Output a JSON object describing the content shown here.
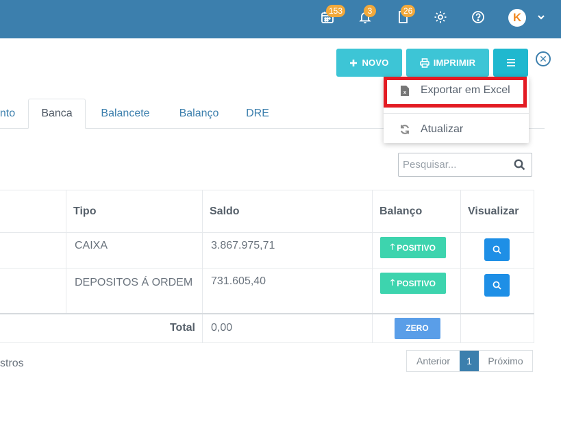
{
  "header": {
    "badges": {
      "calendar": "153",
      "notifications": "3",
      "documents": "26"
    },
    "avatar_letter": "K"
  },
  "toolbar": {
    "novo_label": "NOVO",
    "imprimir_label": "IMPRIMIR"
  },
  "dropdown": {
    "items": [
      {
        "label": "Exportar em Excel",
        "icon": "excel-file-icon"
      },
      {
        "label": "Atualizar",
        "icon": "refresh-icon"
      }
    ]
  },
  "tabs": [
    {
      "label": "nto",
      "active": false
    },
    {
      "label": "Banca",
      "active": true
    },
    {
      "label": "Balancete",
      "active": false
    },
    {
      "label": "Balanço",
      "active": false
    },
    {
      "label": "DRE",
      "active": false
    }
  ],
  "search": {
    "placeholder": "Pesquisar..."
  },
  "table": {
    "headers": [
      "Tipo",
      "Saldo",
      "Balanço",
      "Visualizar"
    ],
    "rows": [
      {
        "tipo": "CAIXA",
        "saldo": "3.867.975,71",
        "balanco": "POSITIVO"
      },
      {
        "tipo": "DEPOSITOS Á ORDEM",
        "saldo": "731.605,40",
        "balanco": "POSITIVO"
      }
    ],
    "total_label": "Total",
    "total_value": "0,00",
    "total_badge": "ZERO"
  },
  "footer": {
    "records_text": "stros",
    "pagination": {
      "prev": "Anterior",
      "current": "1",
      "next": "Próximo"
    }
  },
  "colors": {
    "topbar": "#3c7fad",
    "accent_button": "#3dc5d6",
    "positive": "#3dd4ae",
    "badge": "#f2a93b",
    "highlight": "#e31b23"
  }
}
